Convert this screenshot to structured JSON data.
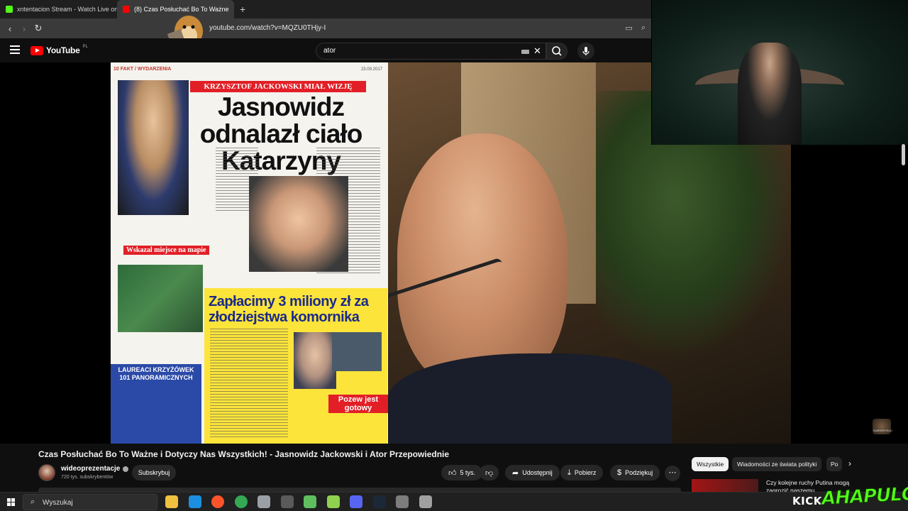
{
  "browser": {
    "tabs": [
      {
        "title": "xntentacion Stream - Watch Live on K",
        "favicon_color": "#53fc18"
      },
      {
        "title": "(8) Czas Posłuchać Bo To Ważne",
        "favicon_color": "#ff0000"
      }
    ],
    "new_tab": "+",
    "url": "youtube.com/watch?v=MQZU0THjy-I"
  },
  "youtube": {
    "logo": "YouTube",
    "region": "PL",
    "search_query": "ator"
  },
  "newspaper": {
    "page": "10",
    "section": "FAKT / WYDARZENIA",
    "date": "23.09.2017",
    "kicker": "KRZYSZTOF JACKOWSKI MIAŁ WIZJĘ",
    "headline": "Jasnowidz odnalazł ciało Katarzyny",
    "caption": "Wskazał miejsce na mapie",
    "subheadline": "Zapłacimy 3 miliony zł za złodziejstwa komornika",
    "box_title": "LAUREACI KRZYŻÓWEK 101 PANORAMICZNYCH",
    "pozew": "Pozew jest gotowy"
  },
  "video": {
    "title": "Czas Posłuchać Bo To Ważne i Dotyczy Nas Wszystkich! - Jasnowidz Jackowski i Ator Przepowiednie",
    "channel": "wideoprezentacje",
    "subscribers": "720 tys. subskrybentów",
    "subscribe_label": "Subskrybuj",
    "likes": "5 tys.",
    "share_label": "Udostępnij",
    "download_label": "Pobierz",
    "thanks_label": "Podziękuj"
  },
  "chips": [
    "Wszystkie",
    "Wiadomości ze świata polityki",
    "Po"
  ],
  "recommendation": {
    "title": "Czy kolejne ruchy Putina mogą zagrozić naszemu..."
  },
  "taskbar": {
    "search_placeholder": "Wyszukaj",
    "apps": [
      {
        "name": "file-explorer",
        "color": "#f0c040"
      },
      {
        "name": "edge",
        "color": "#1d8fe0"
      },
      {
        "name": "brave",
        "color": "#fb542b"
      },
      {
        "name": "chrome",
        "color": "#34a853"
      },
      {
        "name": "app-5",
        "color": "#9aa0a6"
      },
      {
        "name": "obs",
        "color": "#5a5a5a"
      },
      {
        "name": "app-7",
        "color": "#5fbf5f"
      },
      {
        "name": "app-8",
        "color": "#8fd14f"
      },
      {
        "name": "discord",
        "color": "#5865f2"
      },
      {
        "name": "steam",
        "color": "#1b2838"
      },
      {
        "name": "app-11",
        "color": "#7d7d7d"
      },
      {
        "name": "app-12",
        "color": "#a0a0a0"
      }
    ]
  },
  "overlay": {
    "kick_label": "KICK",
    "streamer_name": "AHAPULCO",
    "badge_text": "SUBSKRYBUJ"
  },
  "colors": {
    "accent_red": "#ff0000",
    "kick_green": "#53fc18",
    "background": "#0f0f0f"
  }
}
